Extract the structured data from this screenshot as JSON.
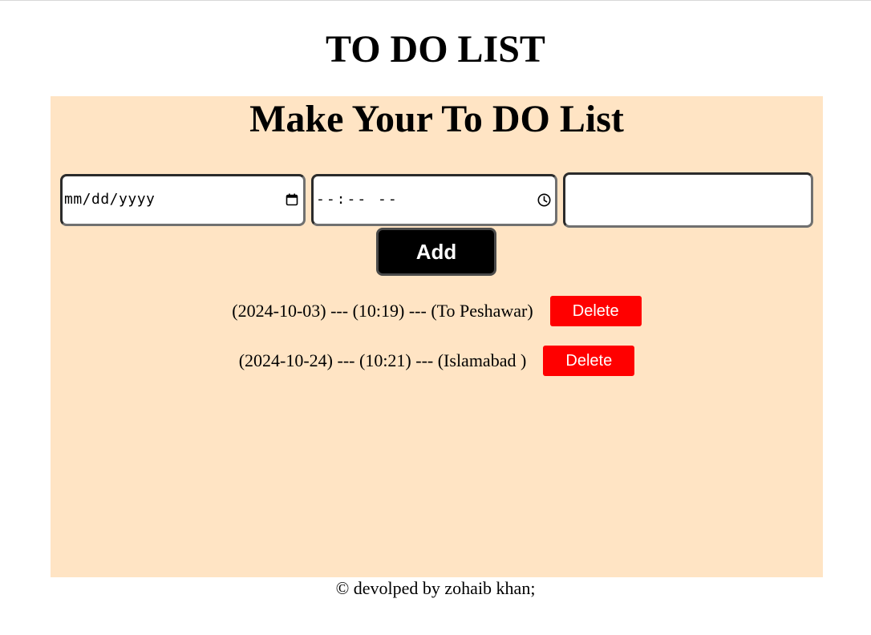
{
  "header": {
    "title": "TO DO LIST"
  },
  "panel": {
    "title": "Make Your To DO List",
    "background": "#ffe4c4"
  },
  "form": {
    "date_placeholder": "mm/dd/yyyy",
    "date_icon": "calendar-icon",
    "time_placeholder": "--:-- --",
    "time_icon": "clock-icon",
    "task_value": "",
    "add_label": "Add"
  },
  "todos": [
    {
      "text": "(2024-10-03) --- (10:19) --- (To Peshawar)",
      "delete_label": "Delete"
    },
    {
      "text": "(2024-10-24) --- (10:21) --- (Islamabad )",
      "delete_label": "Delete"
    }
  ],
  "footer": {
    "text": "© devolped by zohaib khan;"
  },
  "colors": {
    "panel": "#ffe4c4",
    "add_button": "#000000",
    "delete_button": "#ff0000"
  }
}
